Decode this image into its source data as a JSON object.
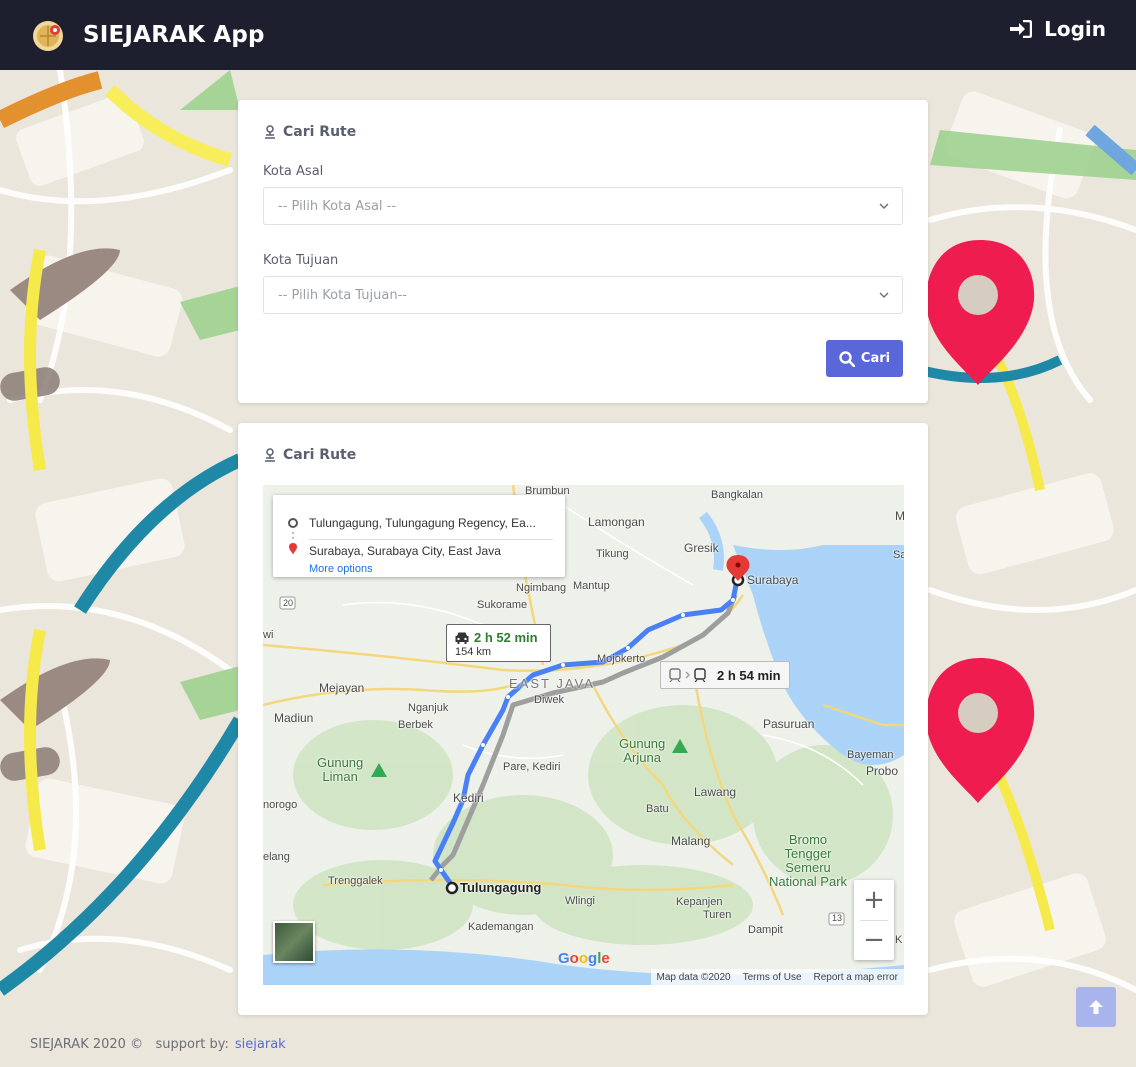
{
  "navbar": {
    "brand": "SIEJARAK App",
    "login_label": "Login"
  },
  "search_card": {
    "title": "Cari Rute",
    "origin_label": "Kota Asal",
    "origin_placeholder": "-- Pilih Kota Asal --",
    "destination_label": "Kota Tujuan",
    "destination_placeholder": "-- Pilih Kota Tujuan--",
    "search_button": "Cari"
  },
  "result_card": {
    "title": "Cari Rute",
    "map": {
      "directions": {
        "origin": "Tulungagung, Tulungagung Regency, Ea...",
        "destination": "Surabaya, Surabaya City, East Java",
        "more_options": "More options"
      },
      "drive": {
        "time": "2 h 52 min",
        "distance": "154 km"
      },
      "transit": {
        "time": "2 h 54 min"
      },
      "places": {
        "brumbun": "Brumbun",
        "bangkalan": "Bangkalan",
        "lamongan": "Lamongan",
        "gresik": "Gresik",
        "tikung": "Tikung",
        "ngimbang": "Ngimbang",
        "mantup": "Mantup",
        "surabaya": "Surabaya",
        "sukorame": "Sukorame",
        "mojokerto": "Mojokerto",
        "east_java": "EAST JAVA",
        "mejayan": "Mejayan",
        "nganjuk": "Nganjuk",
        "diwek": "Diwek",
        "madiun": "Madiun",
        "berbek": "Berbek",
        "pasuruan": "Pasuruan",
        "gunung_arjuna": "Gunung\nArjuna",
        "gunung_liman": "Gunung\nLiman",
        "pare": "Pare, Kediri",
        "bayeman": "Bayeman",
        "probo": "Probo",
        "kediri": "Kediri",
        "lawang": "Lawang",
        "ponorogo": "norogo",
        "batu": "Batu",
        "bromo": "Bromo\nTengger\nSemeru\nNational Park",
        "malang": "Malang",
        "elang": "elang",
        "trenggalek": "Trenggalek",
        "tulungagung": "Tulungagung",
        "wlingi": "Wlingi",
        "kepanjen": "Kepanjen",
        "turen": "Turen",
        "dampit": "Dampit",
        "kademangan": "Kademangan",
        "edge_m": "M",
        "edge_sa": "Sa",
        "edge_wi": "wi",
        "edge_k": "K",
        "road_20": "20",
        "road_13": "13"
      },
      "google": [
        "G",
        "o",
        "o",
        "g",
        "l",
        "e"
      ],
      "footer": {
        "map_data": "Map data ©2020",
        "terms": "Terms of Use",
        "report": "Report a map error"
      }
    }
  },
  "footer": {
    "text": "SIEJARAK 2020 ©   support by:",
    "link": "siejarak"
  },
  "colors": {
    "navbar_bg": "#1d1f2e",
    "accent": "#5a67d8",
    "route_blue": "#4a80f5",
    "drive_time_green": "#2e7d32",
    "pin_red": "#ee1c4f"
  },
  "icons": [
    "logo-globe-icon",
    "sign-in-icon",
    "route-icon",
    "search-icon",
    "chevron-down-icon",
    "car-icon",
    "train-icon",
    "map-pin-icon",
    "arrow-up-icon"
  ]
}
